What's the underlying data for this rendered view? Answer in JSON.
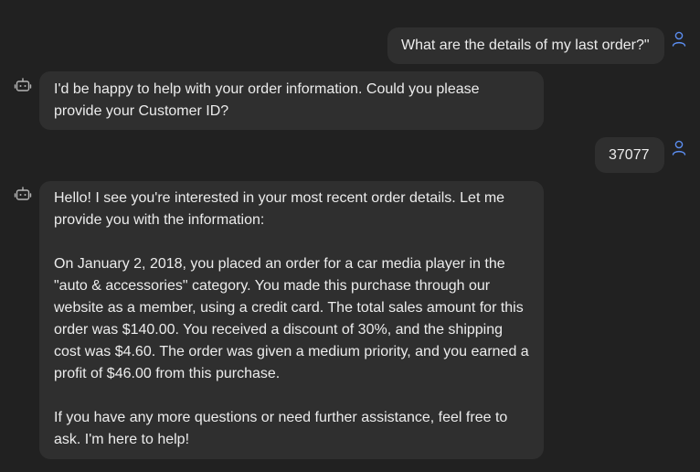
{
  "conversation": {
    "messages": [
      {
        "role": "user",
        "avatar_icon": "user-icon",
        "text": "What are the details of my last order?\""
      },
      {
        "role": "assistant",
        "avatar_icon": "bot-icon",
        "text": "I'd be happy to help with your order information. Could you please\nprovide your Customer ID?"
      },
      {
        "role": "user",
        "avatar_icon": "user-icon",
        "text": "37077"
      },
      {
        "role": "assistant",
        "avatar_icon": "bot-icon",
        "text": "Hello! I see you're interested in your most recent order details. Let me\nprovide you with the information:\n\nOn January 2, 2018, you placed an order for a car media player in the\n\"auto & accessories\" category. You made this purchase through our\nwebsite as a member, using a credit card. The total sales amount for this\norder was $140.00. You received a discount of 30%, and the shipping\ncost was $4.60. The order was given a medium priority, and you earned a\nprofit of $46.00 from this purchase.\n\nIf you have any more questions or need further assistance, feel free to\nask. I'm here to help!"
      }
    ]
  },
  "colors": {
    "background": "#212121",
    "bubble": "#2f2f2f",
    "text": "#ececec",
    "user_icon": "#5b8def",
    "bot_icon": "#b5b5b5"
  }
}
